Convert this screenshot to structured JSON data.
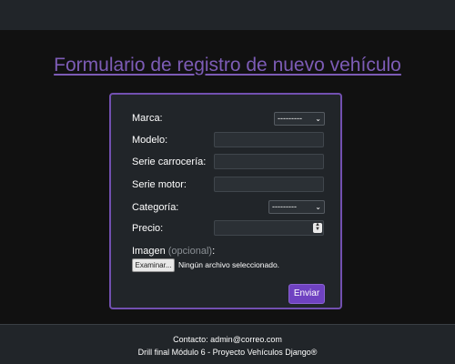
{
  "page": {
    "title": "Formulario de registro de nuevo vehículo"
  },
  "form": {
    "fields": {
      "marca": {
        "label": "Marca:",
        "selected": "---------"
      },
      "modelo": {
        "label": "Modelo:",
        "value": ""
      },
      "serie_carroceria": {
        "label": "Serie carrocería:",
        "value": ""
      },
      "serie_motor": {
        "label": "Serie motor:",
        "value": ""
      },
      "categoria": {
        "label": "Categoría:",
        "selected": "---------"
      },
      "precio": {
        "label": "Precio:",
        "value": ""
      },
      "imagen": {
        "label": "Imagen",
        "optional": "(opcional)",
        "suffix": ":",
        "button_label": "Examinar...",
        "status": "Ningún archivo seleccionado."
      }
    },
    "submit_label": "Enviar"
  },
  "footer": {
    "contact": "Contacto: admin@correo.com",
    "credits": "Drill final Módulo 6 - Proyecto Vehículos Django®"
  },
  "colors": {
    "accent": "#6f42c1",
    "title": "#7d5cb6",
    "background": "#111111",
    "card": "#212529"
  }
}
